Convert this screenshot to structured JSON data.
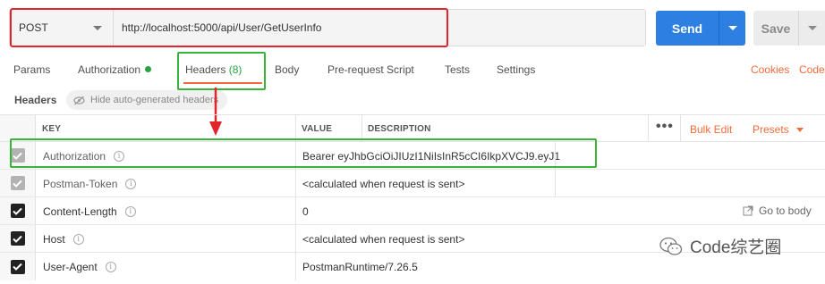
{
  "request": {
    "method": "POST",
    "url": "http://localhost:5000/api/User/GetUserInfo",
    "send_label": "Send",
    "save_label": "Save"
  },
  "tabs": [
    {
      "label": "Params"
    },
    {
      "label": "Authorization"
    },
    {
      "label": "Headers",
      "count": "(8)"
    },
    {
      "label": "Body"
    },
    {
      "label": "Pre-request Script"
    },
    {
      "label": "Tests"
    },
    {
      "label": "Settings"
    }
  ],
  "tab_links": {
    "cookies": "Cookies",
    "code": "Code"
  },
  "headers_section": {
    "title": "Headers",
    "hide_label": "Hide auto-generated headers"
  },
  "table": {
    "columns": {
      "key": "KEY",
      "value": "VALUE",
      "description": "DESCRIPTION"
    },
    "more_label": "•••",
    "bulk_edit": "Bulk Edit",
    "presets": "Presets",
    "rows": [
      {
        "key": "Authorization",
        "value": "Bearer eyJhbGciOiJIUzI1NiIsInR5cCI6IkpXVCJ9.eyJ1",
        "checked": "dim"
      },
      {
        "key": "Postman-Token",
        "value": "<calculated when request is sent>",
        "checked": "dim"
      },
      {
        "key": "Content-Length",
        "value": "0",
        "checked": "on"
      },
      {
        "key": "Host",
        "value": "<calculated when request is sent>",
        "checked": "on"
      },
      {
        "key": "User-Agent",
        "value": "PostmanRuntime/7.26.5",
        "checked": "on"
      }
    ],
    "go_to_body": "Go to body"
  },
  "watermark": {
    "text": "Code综艺圈"
  },
  "colors": {
    "accent_orange": "#f26b3a",
    "send_blue": "#2d7fe2",
    "annotation_red": "#e2242b",
    "annotation_green": "#3ab33a",
    "status_green": "#27a341"
  },
  "icons": {
    "method_caret": "chevron-down-icon",
    "hide_headers": "eye-off-icon",
    "info": "info-icon",
    "go_to_body": "external-link-icon",
    "watermark": "wechat-icon"
  }
}
